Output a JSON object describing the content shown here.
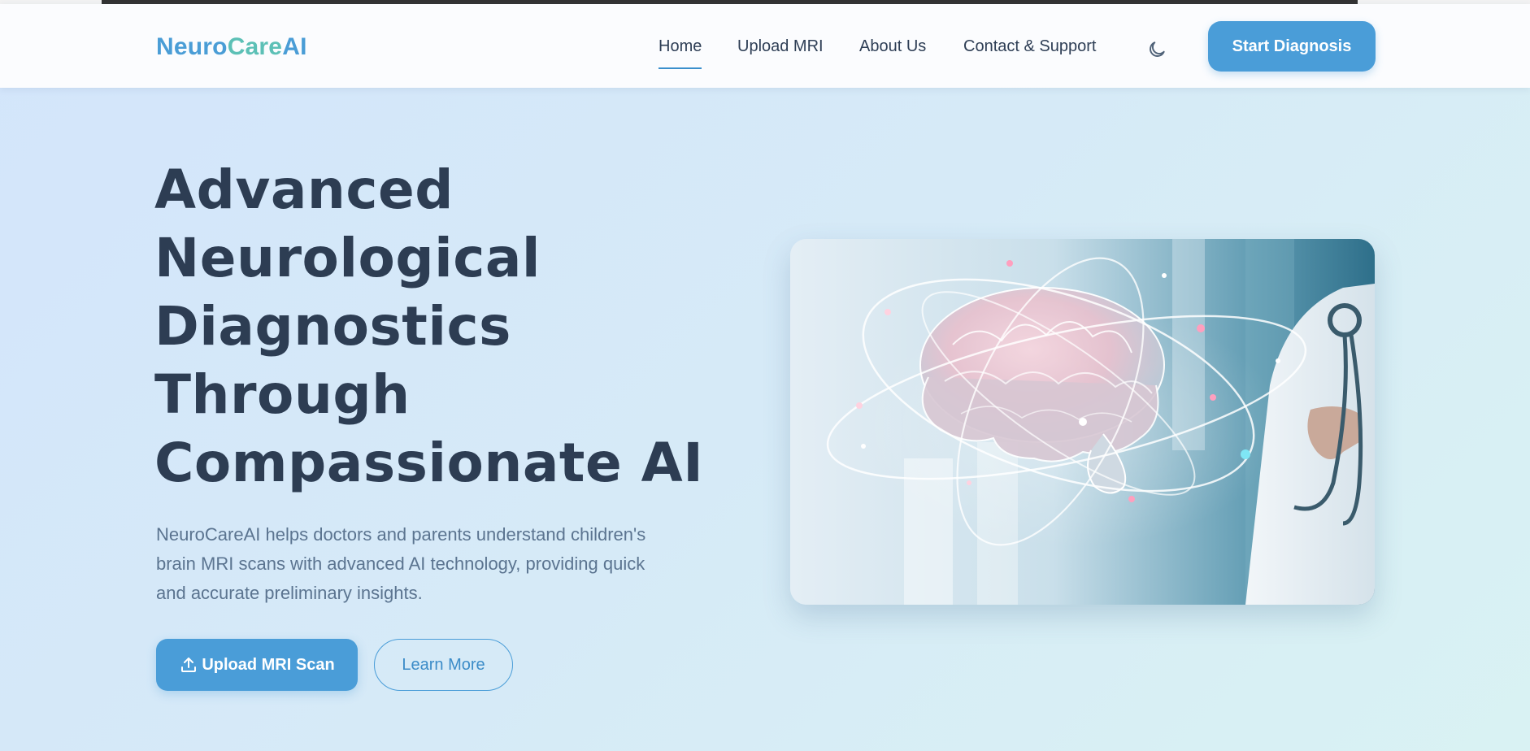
{
  "header": {
    "logo": {
      "part1": "Neuro",
      "part2": "Care",
      "part3": "AI"
    },
    "nav": [
      {
        "label": "Home",
        "active": true
      },
      {
        "label": "Upload MRI",
        "active": false
      },
      {
        "label": "About Us",
        "active": false
      },
      {
        "label": "Contact & Support",
        "active": false
      }
    ],
    "theme_toggle_icon": "moon-icon",
    "cta_label": "Start Diagnosis"
  },
  "hero": {
    "title_lines": [
      "Advanced",
      "Neurological",
      "Diagnostics",
      "Through",
      "Compassionate AI"
    ],
    "description": "NeuroCareAI helps doctors and parents understand children's brain MRI scans with advanced AI technology, providing quick and accurate preliminary insights.",
    "primary_button": {
      "icon": "upload-icon",
      "label": "Upload MRI Scan"
    },
    "secondary_button": {
      "label": "Learn More"
    },
    "image": {
      "subject": "glowing brain with orbital rings held near doctor with stethoscope"
    }
  },
  "colors": {
    "accent": "#4a9dd8",
    "logo_teal": "#5cc0b6",
    "heading": "#2d3d53",
    "body_text": "#5b7490"
  }
}
